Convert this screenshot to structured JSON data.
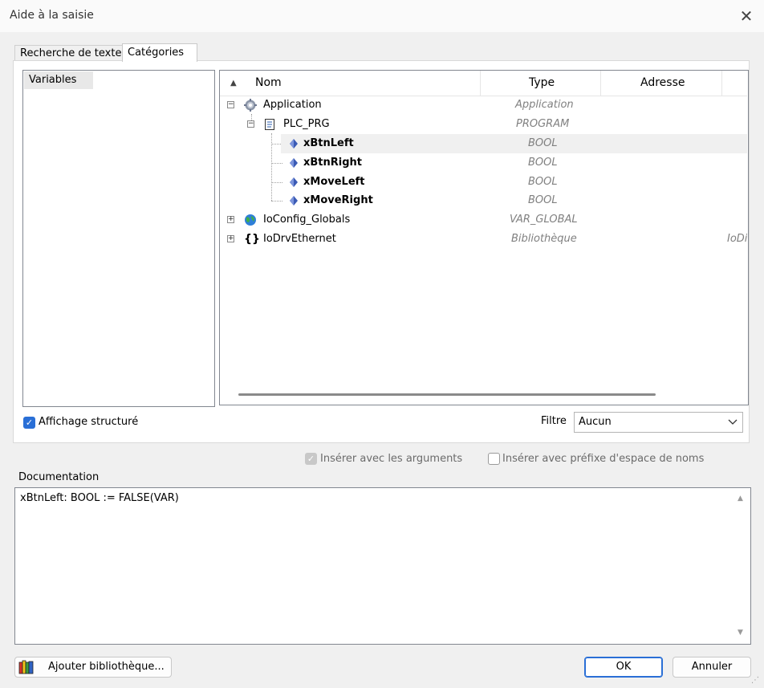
{
  "window": {
    "title": "Aide à la saisie",
    "close_glyph": "✕"
  },
  "tabs": [
    {
      "label": "Recherche de texte"
    },
    {
      "label": "Catégories"
    }
  ],
  "categories": [
    {
      "label": "Variables"
    }
  ],
  "tree": {
    "columns": {
      "name": "Nom",
      "type": "Type",
      "address": "Adresse"
    },
    "rows": [
      {
        "name": "Application",
        "type": "Application",
        "address": "",
        "icon": "gear-icon",
        "expander": "−"
      },
      {
        "name": "PLC_PRG",
        "type": "PROGRAM",
        "address": "",
        "icon": "program-document-icon",
        "expander": "−"
      },
      {
        "name": "xBtnLeft",
        "type": "BOOL",
        "address": "",
        "icon": "variable-icon"
      },
      {
        "name": "xBtnRight",
        "type": "BOOL",
        "address": "",
        "icon": "variable-icon"
      },
      {
        "name": "xMoveLeft",
        "type": "BOOL",
        "address": "",
        "icon": "variable-icon"
      },
      {
        "name": "xMoveRight",
        "type": "BOOL",
        "address": "",
        "icon": "variable-icon"
      },
      {
        "name": "IoConfig_Globals",
        "type": "VAR_GLOBAL",
        "address": "",
        "icon": "globe-icon",
        "expander": "+"
      },
      {
        "name": "IoDrvEthernet",
        "type": "Bibliothèque",
        "address": "IoDi",
        "icon": "braces-icon",
        "expander": "+"
      }
    ]
  },
  "options": {
    "structured_view": "Affichage structuré",
    "filter_label": "Filtre",
    "filter_value": "Aucun",
    "insert_with_args": "Insérer avec les arguments",
    "insert_with_namespace": "Insérer avec préfixe d'espace de noms"
  },
  "documentation": {
    "label": "Documentation",
    "text": "xBtnLeft: BOOL := FALSE(VAR)"
  },
  "buttons": {
    "add_library": "Ajouter bibliothèque...",
    "ok": "OK",
    "cancel": "Annuler"
  },
  "colors": {
    "accent": "#2a6fd6",
    "variable_icon": "#3b5bb5"
  }
}
